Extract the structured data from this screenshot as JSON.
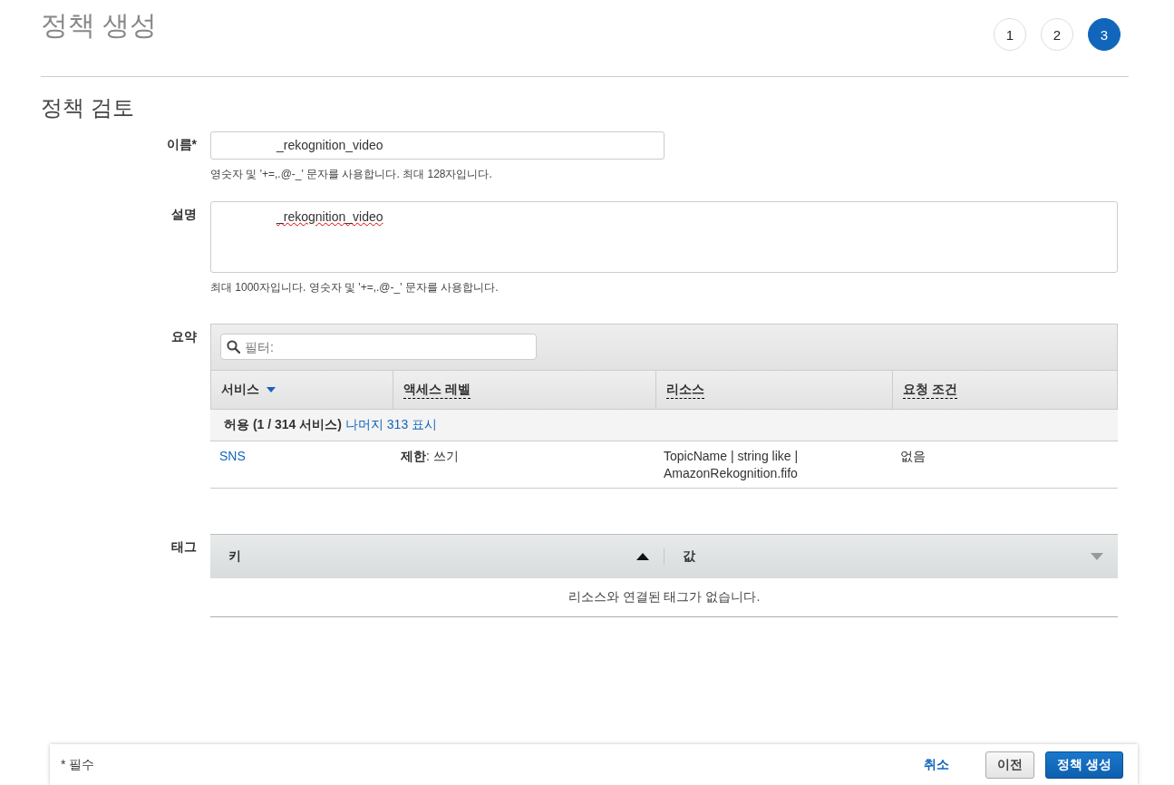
{
  "header": {
    "title": "정책 생성",
    "steps": [
      {
        "label": "1",
        "selected": false
      },
      {
        "label": "2",
        "selected": false
      },
      {
        "label": "3",
        "selected": true
      }
    ]
  },
  "section_title": "정책 검토",
  "name_field": {
    "label": "이름*",
    "value": "_rekognition_video",
    "hint": "영숫자 및 '+=,.@-_' 문자를 사용합니다. 최대 128자입니다."
  },
  "description_field": {
    "label": "설명",
    "value": "_rekognition_video",
    "hint": "최대 1000자입니다. 영숫자 및 '+=,.@-_' 문자를 사용합니다."
  },
  "summary": {
    "label": "요약",
    "filter": {
      "placeholder": "필터:"
    },
    "columns": [
      {
        "label": "서비스",
        "sorted": true,
        "dotted": false
      },
      {
        "label": "액세스 레벨",
        "sorted": false,
        "dotted": true
      },
      {
        "label": "리소스",
        "sorted": false,
        "dotted": true
      },
      {
        "label": "요청 조건",
        "sorted": false,
        "dotted": true
      }
    ],
    "group": {
      "label": "허용 (1 / 314 서비스)",
      "link": "나머지 313 표시"
    },
    "rows": [
      {
        "service": "SNS",
        "access_bold": "제한",
        "access_rest": ": 쓰기",
        "resource_lines": [
          "TopicName | string like |",
          "AmazonRekognition.fifo"
        ],
        "condition": "없음"
      }
    ]
  },
  "tags": {
    "label": "태그",
    "columns": [
      {
        "label": "키",
        "sorted": true
      },
      {
        "label": "값",
        "sorted": false
      }
    ],
    "empty_message": "리소스와 연결된 태그가 없습니다."
  },
  "footer": {
    "required_note": "* 필수",
    "buttons": [
      {
        "label": "취소",
        "kind": "link"
      },
      {
        "label": "이전",
        "kind": "secondary"
      },
      {
        "label": "정책 생성",
        "kind": "primary"
      }
    ]
  }
}
